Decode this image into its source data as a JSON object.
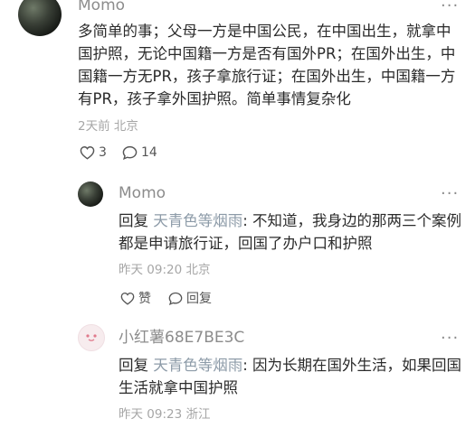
{
  "comment": {
    "author": "Momo",
    "text": "多简单的事；父母一方是中国公民，在中国出生，就拿中国护照，无论中国籍一方是否有国外PR；在国外出生，中国籍一方无PR，孩子拿旅行证；在国外出生，中国籍一方有PR，孩子拿外国护照。简单事情复杂化",
    "time": "2天前",
    "location": "北京",
    "like_count": "3",
    "reply_count": "14"
  },
  "replies": [
    {
      "author": "Momo",
      "reply_label": "回复",
      "reply_to": "天青色等烟雨",
      "text": ": 不知道，我身边的那两三个案例都是申请旅行证，回国了办户口和护照",
      "time": "昨天 09:20",
      "location": "北京",
      "like_label": "赞",
      "reply_action_label": "回复"
    },
    {
      "author": "小红薯68E7BE3C",
      "reply_label": "回复",
      "reply_to": "天青色等烟雨",
      "text": ": 因为长期在国外生活，如果回国生活就拿中国护照",
      "time": "昨天 09:23",
      "location": "浙江"
    }
  ],
  "more_label": "···"
}
